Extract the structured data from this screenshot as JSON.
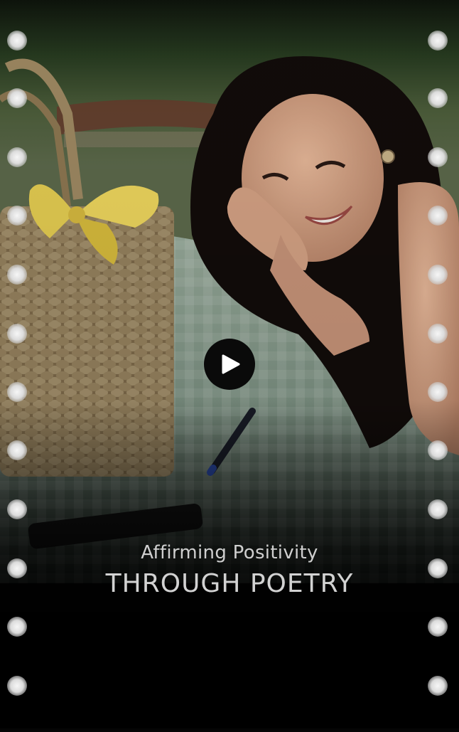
{
  "video": {
    "subtitle": "Affirming Positivity",
    "title": "THROUGH POETRY",
    "play_icon": "play-icon",
    "accent_color": "#0a0a0a",
    "text_color": "#d2d2d2",
    "frame_style": "film-strip"
  }
}
